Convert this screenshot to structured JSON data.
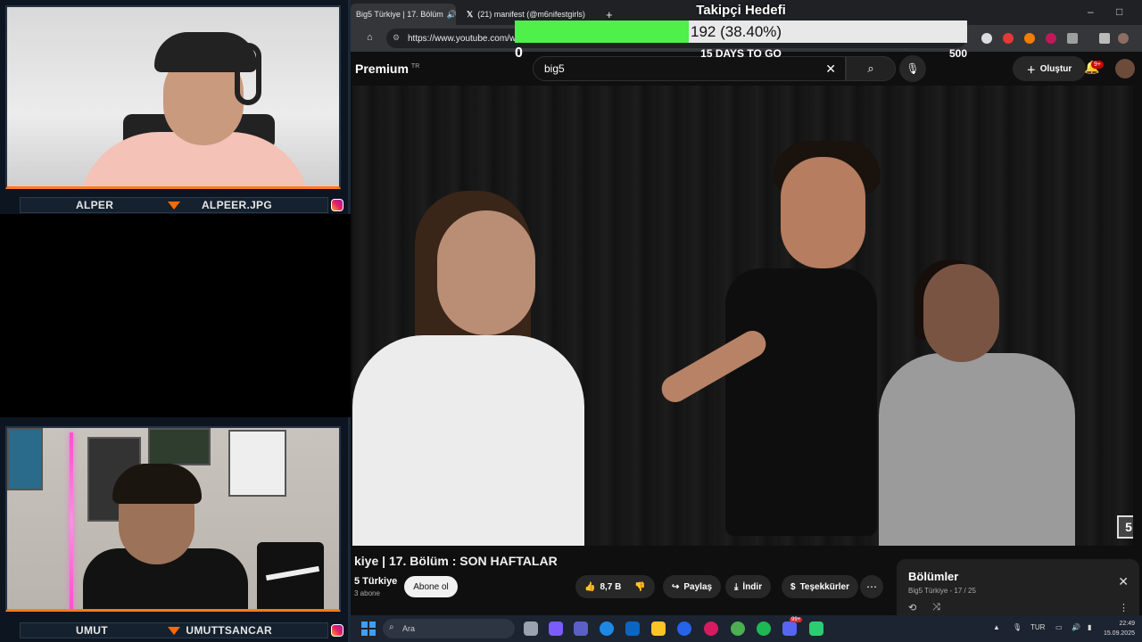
{
  "stream": {
    "top_cam": {
      "left_name": "ALPER",
      "right_handle": "ALPEER.JPG"
    },
    "bottom_cam": {
      "left_name": "UMUT",
      "right_handle": "UMUTTSANCAR"
    }
  },
  "browser": {
    "tabs": [
      {
        "label": "Big5 Türkiye | 17. Bölüm",
        "active": true
      },
      {
        "label": "(21) manifest (@m6nifestgirls)",
        "active": false
      }
    ],
    "new_tab": "+",
    "url": "https://www.youtube.com/wa",
    "window_controls": {
      "minimize": "–",
      "maximize": "□"
    }
  },
  "youtube": {
    "brand": "Premium",
    "brand_region": "TR",
    "search_value": "big5",
    "create_label": "Oluştur",
    "notif_badge": "9+",
    "video_title": "kiye | 17. Bölüm : SON HAFTALAR",
    "channel_name": "5 Türkiye",
    "channel_subs": "3 abone",
    "subscribe_label": "Abone ol",
    "like_count": "8,7 B",
    "share_label": "Paylaş",
    "download_label": "İndir",
    "thanks_label": "Teşekkürler",
    "corner_logo": "5",
    "playlist": {
      "title": "Bölümler",
      "subtitle": "Big5 Türkiye - 17 / 25"
    }
  },
  "goal": {
    "title": "Takipçi Hedefi",
    "value_text": "192 (38.40%)",
    "progress": 0.384,
    "min": "0",
    "max": "500",
    "days_left": "15 DAYS TO GO",
    "fill_color": "#4ff04a"
  },
  "taskbar": {
    "search_placeholder": "Ara",
    "lang": "TUR",
    "time": "22:49",
    "date": "15.09.2025",
    "discord_badge": "99+"
  }
}
